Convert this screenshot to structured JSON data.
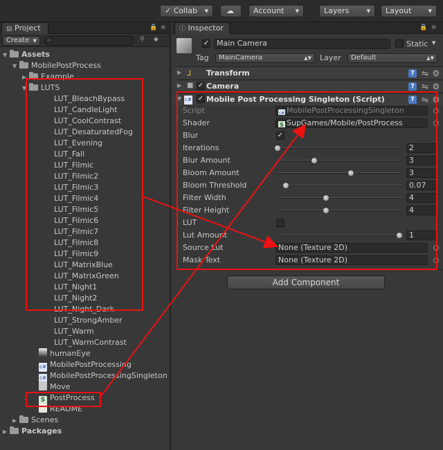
{
  "toolbar": {
    "collab": "✓ Collab",
    "cloud_icon": "cloud-icon",
    "account": "Account",
    "layers": "Layers",
    "layout": "Layout"
  },
  "project": {
    "tab": "Project",
    "create": "Create",
    "tree": [
      {
        "label": "Assets",
        "kind": "folder",
        "indent": 0,
        "bold": true,
        "fold": "open"
      },
      {
        "label": "MobilePostProcess",
        "kind": "folder",
        "indent": 1,
        "fold": "open"
      },
      {
        "label": "Example",
        "kind": "folder",
        "indent": 2,
        "fold": "closed"
      },
      {
        "label": "LUTS",
        "kind": "folder",
        "indent": 2,
        "fold": "open"
      },
      {
        "label": "LUT_BleachBypass",
        "kind": "none",
        "indent": 4
      },
      {
        "label": "LUT_CandleLight",
        "kind": "none",
        "indent": 4
      },
      {
        "label": "LUT_CoolContrast",
        "kind": "none",
        "indent": 4
      },
      {
        "label": "LUT_DesaturatedFog",
        "kind": "none",
        "indent": 4
      },
      {
        "label": "LUT_Evening",
        "kind": "none",
        "indent": 4
      },
      {
        "label": "LUT_Fall",
        "kind": "none",
        "indent": 4
      },
      {
        "label": "LUT_Filmic",
        "kind": "none",
        "indent": 4
      },
      {
        "label": "LUT_Filmic2",
        "kind": "none",
        "indent": 4
      },
      {
        "label": "LUT_Filmic3",
        "kind": "none",
        "indent": 4
      },
      {
        "label": "LUT_Filmic4",
        "kind": "none",
        "indent": 4
      },
      {
        "label": "LUT_Filmic5",
        "kind": "none",
        "indent": 4
      },
      {
        "label": "LUT_Filmic6",
        "kind": "none",
        "indent": 4
      },
      {
        "label": "LUT_Filmic7",
        "kind": "none",
        "indent": 4
      },
      {
        "label": "LUT_Filmic8",
        "kind": "none",
        "indent": 4
      },
      {
        "label": "LUT_Filmic9",
        "kind": "none",
        "indent": 4
      },
      {
        "label": "LUT_MatrixBlue",
        "kind": "none",
        "indent": 4
      },
      {
        "label": "LUT_MatrixGreen",
        "kind": "none",
        "indent": 4
      },
      {
        "label": "LUT_Night1",
        "kind": "none",
        "indent": 4
      },
      {
        "label": "LUT_Night2",
        "kind": "none",
        "indent": 4
      },
      {
        "label": "LUT_Night_Dark",
        "kind": "none",
        "indent": 4
      },
      {
        "label": "LUT_StrongAmber",
        "kind": "none",
        "indent": 4
      },
      {
        "label": "LUT_Warm",
        "kind": "none",
        "indent": 4
      },
      {
        "label": "LUT_WarmContrast",
        "kind": "none",
        "indent": 4
      },
      {
        "label": "humanEye",
        "kind": "tex",
        "indent": 3
      },
      {
        "label": "MobilePostProcessing",
        "kind": "cs",
        "indent": 3
      },
      {
        "label": "MobilePostProcessingSingleton",
        "kind": "cs",
        "indent": 3
      },
      {
        "label": "Move",
        "kind": "move",
        "indent": 3
      },
      {
        "label": "PostProcess",
        "kind": "shader",
        "indent": 3
      },
      {
        "label": "README",
        "kind": "doc",
        "indent": 3
      },
      {
        "label": "Scenes",
        "kind": "folder",
        "indent": 1,
        "fold": "closed"
      },
      {
        "label": "Packages",
        "kind": "folder",
        "indent": 0,
        "bold": true,
        "fold": "closed"
      }
    ]
  },
  "inspector": {
    "tab": "Inspector",
    "object_name": "Main Camera",
    "static_label": "Static",
    "tag_label": "Tag",
    "tag_value": "MainCamera",
    "layer_label": "Layer",
    "layer_value": "Default",
    "transform_title": "Transform",
    "camera_title": "Camera",
    "script_title": "Mobile Post Processing Singleton (Script)",
    "script_label": "Script",
    "script_value": "MobilePostProcessingSingleton",
    "shader_label": "Shader",
    "shader_value": "SupGames/Mobile/PostProcess",
    "blur_label": "Blur",
    "sliders": [
      {
        "label": "Iterations",
        "value": "2",
        "pos": 0.0
      },
      {
        "label": "Blur Amount",
        "value": "3",
        "pos": 0.3
      },
      {
        "label": "Bloom Amount",
        "value": "3",
        "pos": 0.6
      },
      {
        "label": "Bloom Threshold",
        "value": "0.07",
        "pos": 0.07
      },
      {
        "label": "Filter Width",
        "value": "4",
        "pos": 0.4
      },
      {
        "label": "Filter Height",
        "value": "4",
        "pos": 0.4
      }
    ],
    "lut_label": "LUT",
    "lut_amount_label": "Lut Amount",
    "lut_amount_value": "1",
    "lut_amount_pos": 1.0,
    "source_lut_label": "Source Lut",
    "source_lut_value": "None (Texture 2D)",
    "mask_text_label": "Mask Text",
    "mask_text_value": "None (Texture 2D)",
    "add_component": "Add Component"
  }
}
